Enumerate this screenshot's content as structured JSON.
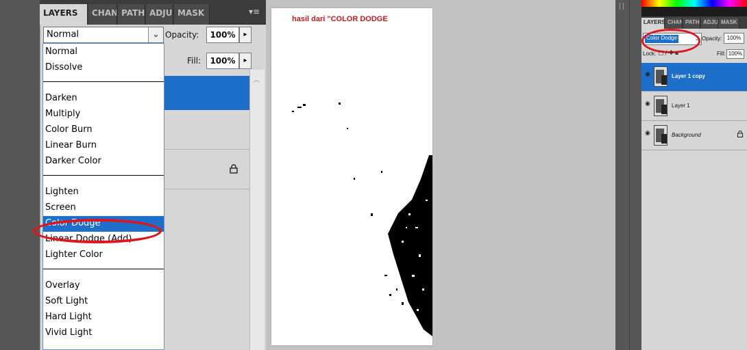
{
  "left_panel": {
    "tabs": [
      "LAYERS",
      "CHAN",
      "PATH",
      "ADJU",
      "MASK"
    ],
    "menu_icon": "panel-menu-icon",
    "blend_mode": "Normal",
    "opacity_label": "Opacity:",
    "opacity_value": "100%",
    "fill_label": "Fill:",
    "fill_value": "100%",
    "dropdown_groups": [
      [
        "Normal",
        "Dissolve"
      ],
      [
        "Darken",
        "Multiply",
        "Color Burn",
        "Linear Burn",
        "Darker Color"
      ],
      [
        "Lighten",
        "Screen",
        "Color Dodge",
        "Linear Dodge (Add)",
        "Lighter Color"
      ],
      [
        "Overlay",
        "Soft Light",
        "Hard Light",
        "Vivid Light"
      ]
    ],
    "dropdown_selected": "Color Dodge"
  },
  "canvas": {
    "caption": "hasil dari \"COLOR DODGE"
  },
  "right_panel": {
    "tabs": [
      "LAYERS",
      "CHAN",
      "PATH",
      "ADJU",
      "MASK"
    ],
    "blend_mode": "Color Dodge",
    "opacity_label": "Opacity:",
    "opacity_value": "100%",
    "lock_label": "Lock:",
    "fill_label": "Fill:",
    "fill_value": "100%",
    "layers": [
      {
        "name": "Layer 1 copy",
        "selected": true,
        "locked": false
      },
      {
        "name": "Layer 1",
        "selected": false,
        "locked": false
      },
      {
        "name": "Background",
        "selected": false,
        "locked": true
      }
    ]
  },
  "colors": {
    "accent_blue": "#1d6fc9",
    "highlight_red": "#e0141c",
    "caption_red": "#c21a1a"
  }
}
